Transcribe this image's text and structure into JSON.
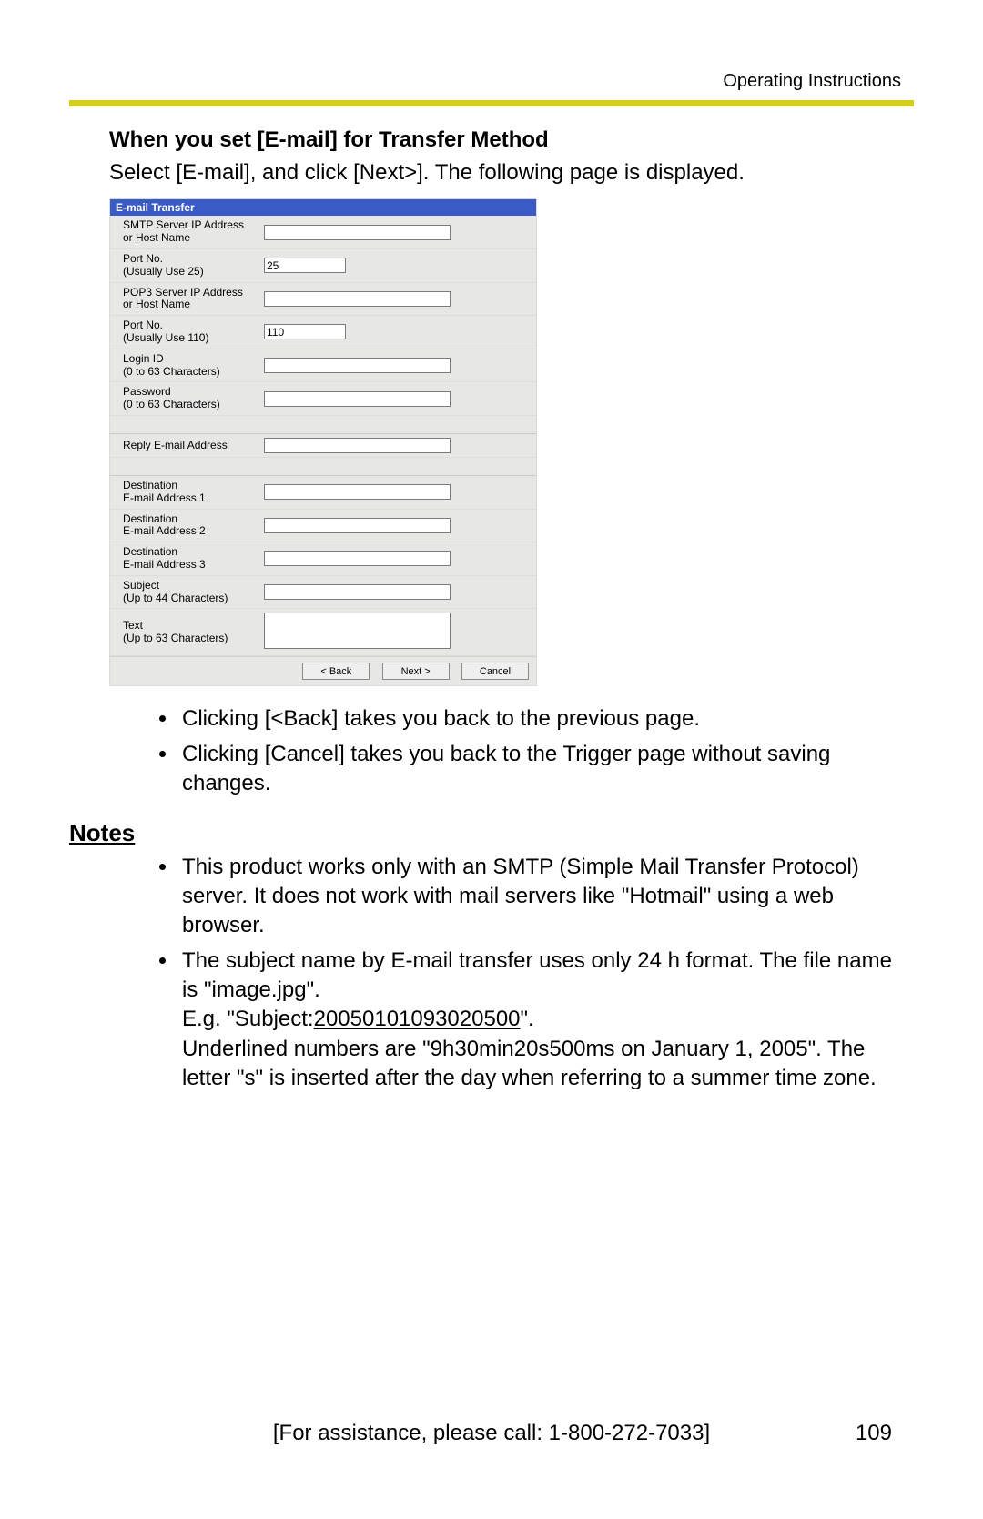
{
  "header": {
    "doc_title": "Operating Instructions"
  },
  "section": {
    "title": "When you set [E-mail] for Transfer Method",
    "intro": "Select [E-mail], and click [Next>]. The following page is displayed."
  },
  "form": {
    "header": "E-mail Transfer",
    "fields": {
      "smtp_label": "SMTP Server IP Address or Host Name",
      "smtp_value": "",
      "smtp_port_label": "Port No.\n(Usually Use 25)",
      "smtp_port_value": "25",
      "pop3_label": "POP3 Server IP Address or Host Name",
      "pop3_value": "",
      "pop3_port_label": "Port No.\n(Usually Use 110)",
      "pop3_port_value": "110",
      "login_label": "Login ID\n(0 to 63 Characters)",
      "login_value": "",
      "pwd_label": "Password\n(0 to 63 Characters)",
      "pwd_value": "",
      "reply_label": "Reply E-mail Address",
      "reply_value": "",
      "dest1_label": "Destination\nE-mail Address 1",
      "dest1_value": "",
      "dest2_label": "Destination\nE-mail Address 2",
      "dest2_value": "",
      "dest3_label": "Destination\nE-mail Address 3",
      "dest3_value": "",
      "subject_label": "Subject\n(Up to 44 Characters)",
      "subject_value": "",
      "text_label": "Text\n(Up to 63 Characters)",
      "text_value": ""
    },
    "buttons": {
      "back": "< Back",
      "next": "Next >",
      "cancel": "Cancel"
    }
  },
  "bullets_after_form": [
    "Clicking [<Back] takes you back to the previous page.",
    "Clicking [Cancel] takes you back to the Trigger page without saving changes."
  ],
  "notes": {
    "heading": "Notes",
    "items": [
      "This product works only with an SMTP (Simple Mail Transfer Protocol) server. It does not work with mail servers like \"Hotmail\" using a web browser.",
      {
        "line1": "The subject name by E-mail transfer uses only 24 h format. The file name is \"image.jpg\".",
        "line2_pre": "E.g. \"Subject:",
        "line2_num": "20050101093020500",
        "line2_post": "\".",
        "line3": "Underlined numbers are \"9h30min20s500ms on January 1, 2005\". The letter \"s\" is inserted after the day when referring to a summer time zone."
      }
    ]
  },
  "footer": {
    "assist": "[For assistance, please call: 1-800-272-7033]",
    "page": "109"
  }
}
